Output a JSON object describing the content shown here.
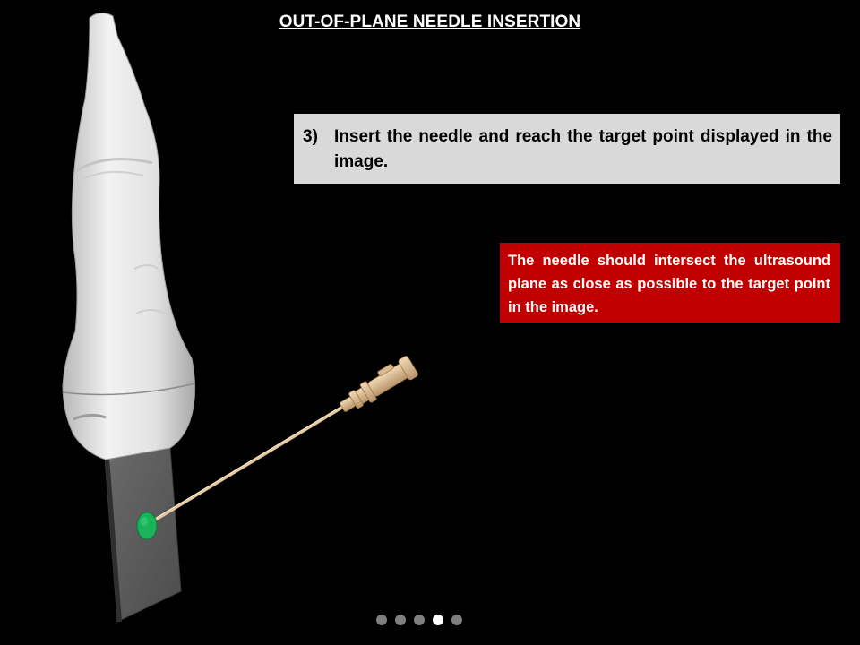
{
  "slide": {
    "title": "OUT-OF-PLANE NEEDLE INSERTION",
    "step": {
      "number": "3)",
      "text": "Insert the needle and reach the target point displayed in the image."
    },
    "note": {
      "text": "The needle should intersect the ultrasound plane as close as possible to the target point in the image."
    }
  },
  "pagination": {
    "total": 5,
    "active_index": 3
  },
  "colors": {
    "background": "#000000",
    "step_box": "#d9d9d9",
    "note_box": "#c00000",
    "target": "#19b45a",
    "needle": "#e6c8a0",
    "probe": "#ededed",
    "plane": "#5e5e5e"
  },
  "icons": {
    "probe": "ultrasound-probe-icon",
    "needle": "needle-icon",
    "target": "target-point-icon"
  }
}
